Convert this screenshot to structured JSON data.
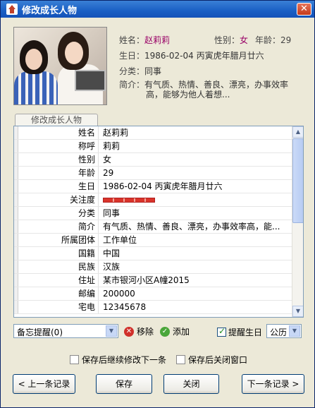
{
  "window": {
    "title": "修改成长人物",
    "close_glyph": "✕"
  },
  "header": {
    "name_label": "姓名：",
    "name_value": "赵莉莉",
    "gender_label": "性别：",
    "gender_value": "女",
    "age_label": "年龄：",
    "age_value": "29",
    "birthday_label": "生日：",
    "birthday_value": "1986-02-04 丙寅虎年腊月廿六",
    "category_label": "分类：",
    "category_value": "同事",
    "intro_label": "简介：",
    "intro_line1": "有气质、热情、善良、漂亮，办事效率",
    "intro_line2": "高，能够为他人着想..."
  },
  "tab": {
    "label": "修改成长人物"
  },
  "grid": {
    "rows": [
      {
        "label": "姓名",
        "value": "赵莉莉"
      },
      {
        "label": "称呼",
        "value": "莉莉"
      },
      {
        "label": "性别",
        "value": "女"
      },
      {
        "label": "年龄",
        "value": "29"
      },
      {
        "label": "生日",
        "value": "1986-02-04 丙寅虎年腊月廿六"
      },
      {
        "label": "关注度",
        "value": ""
      },
      {
        "label": "分类",
        "value": "同事"
      },
      {
        "label": "简介",
        "value": "有气质、热情、善良、漂亮，办事效率高，能..."
      },
      {
        "label": "所属团体",
        "value": "工作单位"
      },
      {
        "label": "国籍",
        "value": "中国"
      },
      {
        "label": "民族",
        "value": "汉族"
      },
      {
        "label": "住址",
        "value": "某市银河小区A幢2015"
      },
      {
        "label": "邮编",
        "value": "200000"
      },
      {
        "label": "宅电",
        "value": "12345678"
      }
    ],
    "attention_level": 1.0
  },
  "controls": {
    "memo_combo": "备忘提醒(0)",
    "remove_label": "移除",
    "add_label": "添加",
    "remind_birthday_label": "提醒生日",
    "remind_checked": true,
    "calendar_value": "公历",
    "continue_label": "保存后继续修改下一条",
    "close_after_label": "保存后关闭窗口"
  },
  "buttons": {
    "prev": "< 上一条记录",
    "save": "保存",
    "close": "关闭",
    "next": "下一条记录 >"
  },
  "colors": {
    "titlebar": "#1a5fc4",
    "window_bg": "#ece9d8",
    "name_accent": "#990066",
    "attention_bar": "#d9342b"
  }
}
